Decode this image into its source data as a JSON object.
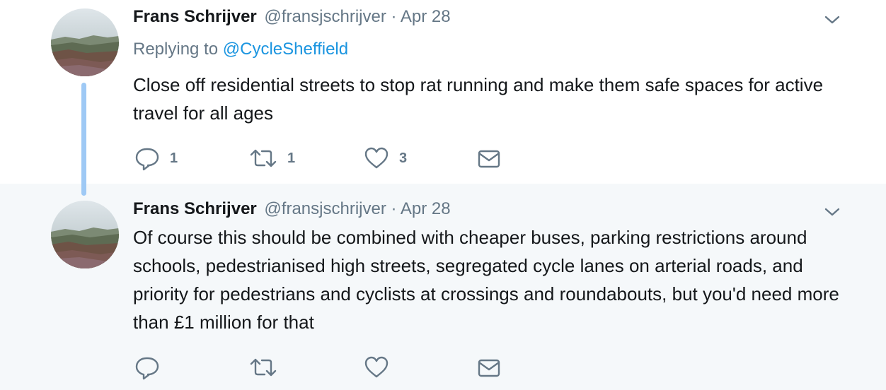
{
  "tweets": [
    {
      "name": "Frans Schrijver",
      "handle": "@fransjschrijver",
      "date": "· Apr 28",
      "replying_label": "Replying to",
      "replying_to": "@CycleSheffield",
      "text": "Close off residential streets to stop rat running and make them safe spaces for active travel for all ages",
      "replies": "1",
      "retweets": "1",
      "likes": "3"
    },
    {
      "name": "Frans Schrijver",
      "handle": "@fransjschrijver",
      "date": "· Apr 28",
      "text": "Of course this should be combined with cheaper buses, parking restrictions around schools, pedestrianised high streets, segregated cycle lanes on arterial roads, and priority for pedestrians and cyclists at crossings and roundabouts, but you'd need more than £1 million for that"
    }
  ],
  "icons": {
    "reply": "reply-icon",
    "retweet": "retweet-icon",
    "like": "like-icon",
    "message": "message-icon",
    "menu": "chevron-down-icon"
  },
  "colors": {
    "icon": "#657786",
    "link": "#1b95e0",
    "thread_line": "#9ec9f5",
    "highlight_bg": "#f5f8fa"
  }
}
